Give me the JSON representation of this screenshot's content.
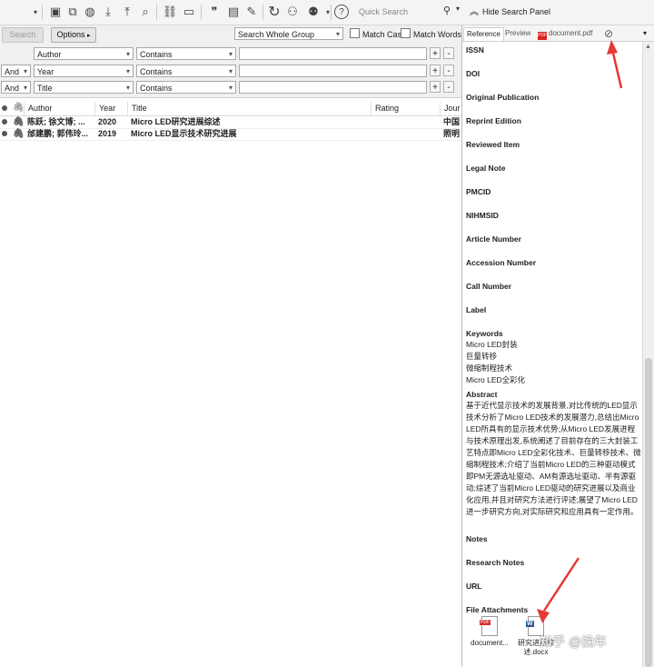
{
  "toolbar": {
    "quick_search_placeholder": "Quick Search",
    "hide_panel_label": "Hide Search Panel"
  },
  "search": {
    "search_button": "Search",
    "options_button": "Options",
    "scope": "Search Whole Group",
    "match_case": "Match Case",
    "match_words": "Match Words",
    "rows": [
      {
        "bool": "",
        "field": "Author",
        "op": "Contains"
      },
      {
        "bool": "And",
        "field": "Year",
        "op": "Contains"
      },
      {
        "bool": "And",
        "field": "Title",
        "op": "Contains"
      }
    ]
  },
  "list": {
    "headers": {
      "author": "Author",
      "year": "Year",
      "title": "Title",
      "rating": "Rating",
      "journal": "Jour"
    },
    "rows": [
      {
        "author": "陈跃; 徐文博; ...",
        "year": "2020",
        "title": "Micro LED研究进展综述",
        "journal": "中国"
      },
      {
        "author": "邰建鹏; 郭伟玲...",
        "year": "2019",
        "title": "Micro LED显示技术研究进展",
        "journal": "照明"
      }
    ]
  },
  "panel": {
    "tabs": {
      "reference": "Reference",
      "preview": "Preview",
      "pdf": "document.pdf"
    },
    "fields": {
      "issn": "ISSN",
      "doi": "DOI",
      "original_publication": "Original Publication",
      "reprint_edition": "Reprint Edition",
      "reviewed_item": "Reviewed Item",
      "legal_note": "Legal Note",
      "pmcid": "PMCID",
      "nihmsid": "NIHMSID",
      "article_number": "Article Number",
      "accession_number": "Accession Number",
      "call_number": "Call Number",
      "label": "Label",
      "keywords": "Keywords",
      "abstract": "Abstract",
      "notes": "Notes",
      "research_notes": "Research Notes",
      "url": "URL",
      "file_attachments": "File Attachments"
    },
    "keywords": [
      "Micro LED封装",
      "巨量转移",
      "微缩制程技术",
      "Micro LED全彩化"
    ],
    "abstract_text": "基于近代显示技术的发展背景,对比传统的LED显示技术分析了Micro LED技术的发展潜力,总结出Micro LED所具有的显示技术优势;从Micro LED发展进程与技术原理出发,系统阐述了目前存在的三大封装工艺特点即Micro LED全彩化技术、巨量转移技术、微缩制程技术;介绍了当前Micro LED的三种驱动模式即PM无源选址驱动、AM有源选址驱动、半有源驱动;综述了当前Micro LED驱动的研究进展以及商业化应用,并且对研究方法进行评述;展望了Micro LED进一步研究方向,对实际研究和应用具有一定作用。",
    "attachments": [
      {
        "name": "document...",
        "icon": "pdf-file-icon",
        "badge": "PDF"
      },
      {
        "name": "研究进展综述.docx",
        "icon": "word-file-icon",
        "badge": "W"
      }
    ]
  },
  "watermark": "知乎 @挽年",
  "colors": {
    "annotation_arrow": "#e53935",
    "pdf_red": "#d32f2f",
    "word_blue": "#2b579a"
  }
}
